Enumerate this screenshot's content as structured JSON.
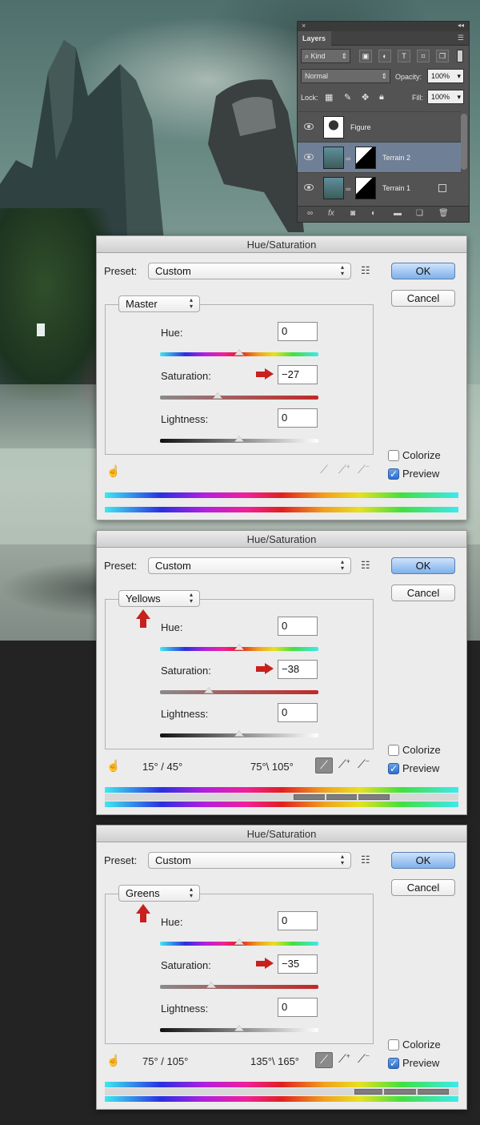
{
  "layers_panel": {
    "tab": "Layers",
    "close_glyph": "×",
    "collapse_glyph": "◂◂",
    "menu_glyph": "☰",
    "kind_label": "Kind",
    "blend_mode": "Normal",
    "opacity_label": "Opacity:",
    "opacity_value": "100%",
    "lock_label": "Lock:",
    "fill_label": "Fill:",
    "fill_value": "100%",
    "layers": [
      {
        "name": "Figure",
        "selected": false
      },
      {
        "name": "Terrain 2",
        "selected": true
      },
      {
        "name": "Terrain 1",
        "selected": false
      }
    ],
    "bottom_icons": [
      "link-icon",
      "fx-icon",
      "mask-icon",
      "adjustment-icon",
      "folder-icon",
      "new-layer-icon",
      "trash-icon"
    ],
    "fx_label": "fx"
  },
  "dialogs": [
    {
      "title": "Hue/Saturation",
      "preset_label": "Preset:",
      "preset_value": "Custom",
      "channel": "Master",
      "ok": "OK",
      "cancel": "Cancel",
      "hue_label": "Hue:",
      "hue_value": "0",
      "saturation_label": "Saturation:",
      "saturation_value": "−27",
      "lightness_label": "Lightness:",
      "lightness_value": "0",
      "colorize_label": "Colorize",
      "colorize_checked": false,
      "preview_label": "Preview",
      "preview_checked": true,
      "hue_slider_fraction": 0.5,
      "saturation_slider_fraction": 0.365,
      "lightness_slider_fraction": 0.5,
      "range_left": "",
      "range_right": ""
    },
    {
      "title": "Hue/Saturation",
      "preset_label": "Preset:",
      "preset_value": "Custom",
      "channel": "Yellows",
      "ok": "OK",
      "cancel": "Cancel",
      "hue_label": "Hue:",
      "hue_value": "0",
      "saturation_label": "Saturation:",
      "saturation_value": "−38",
      "lightness_label": "Lightness:",
      "lightness_value": "0",
      "colorize_label": "Colorize",
      "colorize_checked": false,
      "preview_label": "Preview",
      "preview_checked": true,
      "hue_slider_fraction": 0.5,
      "saturation_slider_fraction": 0.31,
      "lightness_slider_fraction": 0.5,
      "range_left": "15° / 45°",
      "range_right": "75°\\ 105°"
    },
    {
      "title": "Hue/Saturation",
      "preset_label": "Preset:",
      "preset_value": "Custom",
      "channel": "Greens",
      "ok": "OK",
      "cancel": "Cancel",
      "hue_label": "Hue:",
      "hue_value": "0",
      "saturation_label": "Saturation:",
      "saturation_value": "−35",
      "lightness_label": "Lightness:",
      "lightness_value": "0",
      "colorize_label": "Colorize",
      "colorize_checked": false,
      "preview_label": "Preview",
      "preview_checked": true,
      "hue_slider_fraction": 0.5,
      "saturation_slider_fraction": 0.325,
      "lightness_slider_fraction": 0.5,
      "range_left": "75° / 105°",
      "range_right": "135°\\ 165°"
    }
  ],
  "colors": {
    "ok_button": "#7fb0ea",
    "annotation_arrow": "#c8201d",
    "selected_layer": "#6e7f96"
  }
}
